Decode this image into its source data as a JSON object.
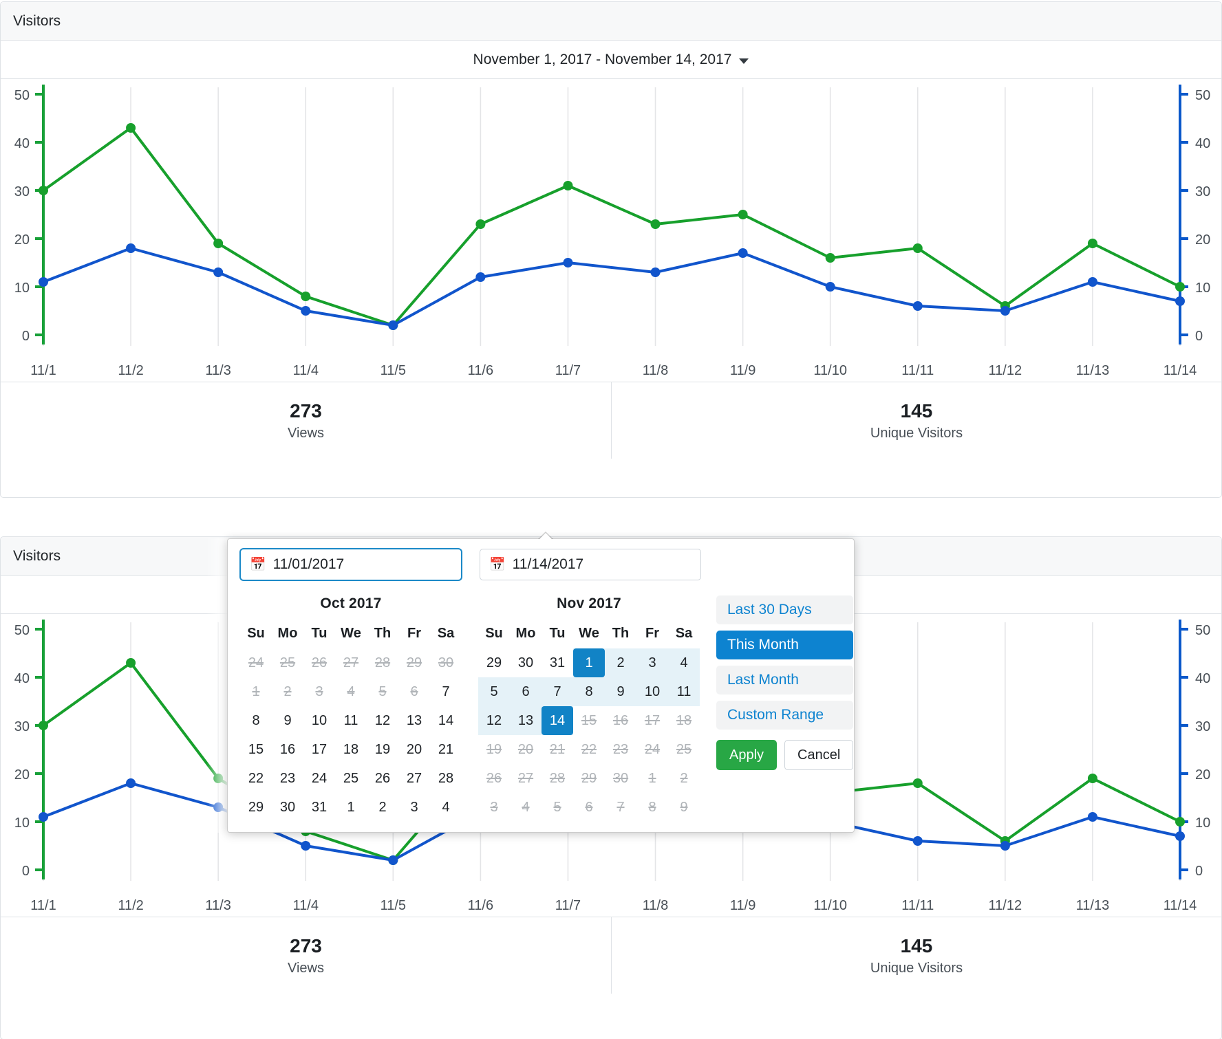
{
  "card": {
    "title": "Visitors",
    "range_label": "November 1, 2017 - November 14, 2017",
    "caret_icon": "chevron-down-icon"
  },
  "totals": [
    {
      "value": "273",
      "label": "Views"
    },
    {
      "value": "145",
      "label": "Unique Visitors"
    }
  ],
  "chart_data": {
    "type": "line",
    "title": "Visitors",
    "xlabel": "",
    "ylabel": "",
    "grid": true,
    "legend": "none",
    "categories": [
      "11/1",
      "11/2",
      "11/3",
      "11/4",
      "11/5",
      "11/6",
      "11/7",
      "11/8",
      "11/9",
      "11/10",
      "11/11",
      "11/12",
      "11/13",
      "11/14"
    ],
    "y_ticks_left": [
      "0",
      "10",
      "20",
      "30",
      "40",
      "50"
    ],
    "y_ticks_right": [
      "0",
      "10",
      "20",
      "30",
      "40",
      "50"
    ],
    "ylim_left": [
      0,
      50
    ],
    "ylim_right": [
      0,
      50
    ],
    "left_axis_color": "#18a038",
    "right_axis_color": "#0a58ca",
    "series": [
      {
        "name": "Views",
        "color": "#17a02c",
        "axis": "left",
        "values": [
          30,
          43,
          19,
          8,
          2,
          23,
          31,
          23,
          25,
          16,
          18,
          6,
          19,
          10
        ]
      },
      {
        "name": "Unique Visitors",
        "color": "#1155cc",
        "axis": "right",
        "values": [
          11,
          18,
          13,
          5,
          2,
          12,
          15,
          13,
          17,
          10,
          6,
          5,
          11,
          7
        ]
      }
    ]
  },
  "datepicker": {
    "start_input": {
      "value": "11/01/2017",
      "placeholder": "mm/dd/yyyy",
      "icon": "calendar-icon"
    },
    "end_input": {
      "value": "11/14/2017",
      "placeholder": "mm/dd/yyyy",
      "icon": "calendar-icon"
    },
    "left_calendar": {
      "title": "Oct 2017",
      "weekdays": [
        "Su",
        "Mo",
        "Tu",
        "We",
        "Th",
        "Fr",
        "Sa"
      ],
      "weeks": [
        [
          {
            "d": "24",
            "s": "strike"
          },
          {
            "d": "25",
            "s": "strike"
          },
          {
            "d": "26",
            "s": "strike"
          },
          {
            "d": "27",
            "s": "strike"
          },
          {
            "d": "28",
            "s": "strike"
          },
          {
            "d": "29",
            "s": "strike"
          },
          {
            "d": "30",
            "s": "strike"
          }
        ],
        [
          {
            "d": "1",
            "s": "strike"
          },
          {
            "d": "2",
            "s": "strike"
          },
          {
            "d": "3",
            "s": "strike"
          },
          {
            "d": "4",
            "s": "strike"
          },
          {
            "d": "5",
            "s": "strike"
          },
          {
            "d": "6",
            "s": "strike"
          },
          {
            "d": "7",
            "s": ""
          }
        ],
        [
          {
            "d": "8",
            "s": ""
          },
          {
            "d": "9",
            "s": ""
          },
          {
            "d": "10",
            "s": ""
          },
          {
            "d": "11",
            "s": ""
          },
          {
            "d": "12",
            "s": ""
          },
          {
            "d": "13",
            "s": ""
          },
          {
            "d": "14",
            "s": ""
          }
        ],
        [
          {
            "d": "15",
            "s": ""
          },
          {
            "d": "16",
            "s": ""
          },
          {
            "d": "17",
            "s": ""
          },
          {
            "d": "18",
            "s": ""
          },
          {
            "d": "19",
            "s": ""
          },
          {
            "d": "20",
            "s": ""
          },
          {
            "d": "21",
            "s": ""
          }
        ],
        [
          {
            "d": "22",
            "s": ""
          },
          {
            "d": "23",
            "s": ""
          },
          {
            "d": "24",
            "s": ""
          },
          {
            "d": "25",
            "s": ""
          },
          {
            "d": "26",
            "s": ""
          },
          {
            "d": "27",
            "s": ""
          },
          {
            "d": "28",
            "s": ""
          }
        ],
        [
          {
            "d": "29",
            "s": ""
          },
          {
            "d": "30",
            "s": ""
          },
          {
            "d": "31",
            "s": ""
          },
          {
            "d": "1",
            "s": "off"
          },
          {
            "d": "2",
            "s": "off"
          },
          {
            "d": "3",
            "s": "off"
          },
          {
            "d": "4",
            "s": "off"
          }
        ]
      ]
    },
    "right_calendar": {
      "title": "Nov 2017",
      "weekdays": [
        "Su",
        "Mo",
        "Tu",
        "We",
        "Th",
        "Fr",
        "Sa"
      ],
      "weeks": [
        [
          {
            "d": "29",
            "s": "off"
          },
          {
            "d": "30",
            "s": "off"
          },
          {
            "d": "31",
            "s": "off"
          },
          {
            "d": "1",
            "s": "sel"
          },
          {
            "d": "2",
            "s": "inrange"
          },
          {
            "d": "3",
            "s": "inrange"
          },
          {
            "d": "4",
            "s": "inrange"
          }
        ],
        [
          {
            "d": "5",
            "s": "inrange"
          },
          {
            "d": "6",
            "s": "inrange"
          },
          {
            "d": "7",
            "s": "inrange"
          },
          {
            "d": "8",
            "s": "inrange"
          },
          {
            "d": "9",
            "s": "inrange"
          },
          {
            "d": "10",
            "s": "inrange"
          },
          {
            "d": "11",
            "s": "inrange"
          }
        ],
        [
          {
            "d": "12",
            "s": "inrange"
          },
          {
            "d": "13",
            "s": "inrange"
          },
          {
            "d": "14",
            "s": "sel"
          },
          {
            "d": "15",
            "s": "strike"
          },
          {
            "d": "16",
            "s": "strike"
          },
          {
            "d": "17",
            "s": "strike"
          },
          {
            "d": "18",
            "s": "strike"
          }
        ],
        [
          {
            "d": "19",
            "s": "strike"
          },
          {
            "d": "20",
            "s": "strike"
          },
          {
            "d": "21",
            "s": "strike"
          },
          {
            "d": "22",
            "s": "strike"
          },
          {
            "d": "23",
            "s": "strike"
          },
          {
            "d": "24",
            "s": "strike"
          },
          {
            "d": "25",
            "s": "strike"
          }
        ],
        [
          {
            "d": "26",
            "s": "strike"
          },
          {
            "d": "27",
            "s": "strike"
          },
          {
            "d": "28",
            "s": "strike"
          },
          {
            "d": "29",
            "s": "strike"
          },
          {
            "d": "30",
            "s": "strike"
          },
          {
            "d": "1",
            "s": "strike"
          },
          {
            "d": "2",
            "s": "strike"
          }
        ],
        [
          {
            "d": "3",
            "s": "strike"
          },
          {
            "d": "4",
            "s": "strike"
          },
          {
            "d": "5",
            "s": "strike"
          },
          {
            "d": "6",
            "s": "strike"
          },
          {
            "d": "7",
            "s": "strike"
          },
          {
            "d": "8",
            "s": "strike"
          },
          {
            "d": "9",
            "s": "strike"
          }
        ]
      ]
    },
    "ranges": [
      {
        "label": "Last 30 Days",
        "active": false
      },
      {
        "label": "This Month",
        "active": true
      },
      {
        "label": "Last Month",
        "active": false
      },
      {
        "label": "Custom Range",
        "active": false
      }
    ],
    "apply_label": "Apply",
    "cancel_label": "Cancel"
  }
}
